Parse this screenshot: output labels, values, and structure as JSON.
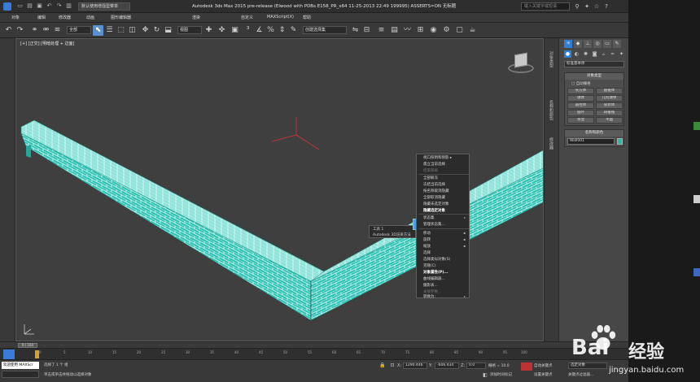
{
  "titlebar": {
    "workspace": "默认使用增强型菜单",
    "title": "Autodesk 3ds Max  2015 pre-release (Elwood with PDBs E158_PR_x64 11-25-2013 22:49 199995) ASSERTS=ON   无标题",
    "search_placeholder": "键入关键字或短语"
  },
  "menu": [
    "对象",
    "编辑",
    "修改器",
    "动画",
    "图形编辑器",
    "渲染",
    "自定义",
    "MAXScript(X)",
    "帮助"
  ],
  "toolbar": {
    "selection_filter": "全部",
    "ref_coord": "视图",
    "named_set": "创建选择集"
  },
  "viewport": {
    "label": "[+] [正交] [明暗处理 + 边面]"
  },
  "context_menu": {
    "quad_upper_left": "视口照明和阴影 ▸",
    "items": [
      {
        "label": "孤立当前选择",
        "state": "norm"
      },
      {
        "label": "结束隔离",
        "state": "dim"
      },
      {
        "label": "全部解冻",
        "state": "norm"
      },
      {
        "label": "冻结当前选择",
        "state": "norm"
      },
      {
        "label": "按名称取消隐藏",
        "state": "norm"
      },
      {
        "label": "全部取消隐藏",
        "state": "norm"
      },
      {
        "label": "隐藏未选定对象",
        "state": "norm"
      },
      {
        "label": "隐藏选定对象",
        "state": "hl"
      },
      {
        "label": "状态集",
        "state": "norm"
      },
      {
        "label": "管理状态集...",
        "state": "norm"
      },
      {
        "label": "移动",
        "state": "norm"
      },
      {
        "label": "旋转",
        "state": "norm"
      },
      {
        "label": "缩放",
        "state": "norm"
      },
      {
        "label": "选择",
        "state": "norm"
      },
      {
        "label": "选择类似对象(S)",
        "state": "norm"
      },
      {
        "label": "克隆(C)",
        "state": "norm"
      },
      {
        "label": "对象属性(P)...",
        "state": "hl"
      },
      {
        "label": "曲线编辑器...",
        "state": "norm"
      },
      {
        "label": "摄影表...",
        "state": "norm"
      },
      {
        "label": "关联参数...",
        "state": "dim"
      },
      {
        "label": "转换为:",
        "state": "norm"
      }
    ],
    "left_items": [
      "工具 1",
      "Autodesk 3D渲染方法"
    ]
  },
  "command_panel": {
    "category": "标准基本体",
    "object_type_header": "对象类型",
    "autogrid": "自动栅格",
    "buttons": [
      "长方体",
      "圆锥体",
      "球体",
      "几何球体",
      "圆柱体",
      "管状体",
      "圆环",
      "四棱锥",
      "茶壶",
      "平面"
    ],
    "name_color_header": "名称和颜色",
    "object_name": "Wall001",
    "side_tabs": [
      "对象类型",
      "名称和颜色",
      "修改器"
    ]
  },
  "timeline": {
    "frame": "0 / 100",
    "ticks": [
      "0",
      "5",
      "10",
      "15",
      "20",
      "25",
      "30",
      "35",
      "40",
      "45",
      "50",
      "55",
      "60",
      "65",
      "70",
      "75",
      "80",
      "85",
      "90",
      "95",
      "100"
    ]
  },
  "status": {
    "maxscript": "欢迎使用 MAXScr",
    "selected": "选择了 1 个 组",
    "prompt": "单击或单击并拖动以选择对象",
    "x_label": "X:",
    "y_label": "Y:",
    "z_label": "Z:",
    "x_value": "1290.446",
    "y_value": "-606.434",
    "z_value": "0.0",
    "grid": "栅格 = 10.0",
    "autokey": "自动关键点",
    "setkey": "设置关键点",
    "keydrop": "选定对象",
    "addtime": "添加时间标记",
    "keyfilter": "关键点过滤器..."
  },
  "watermark": {
    "brand": "Bai",
    "brand_cn": "经验",
    "url": "jingyan.baidu.com"
  }
}
